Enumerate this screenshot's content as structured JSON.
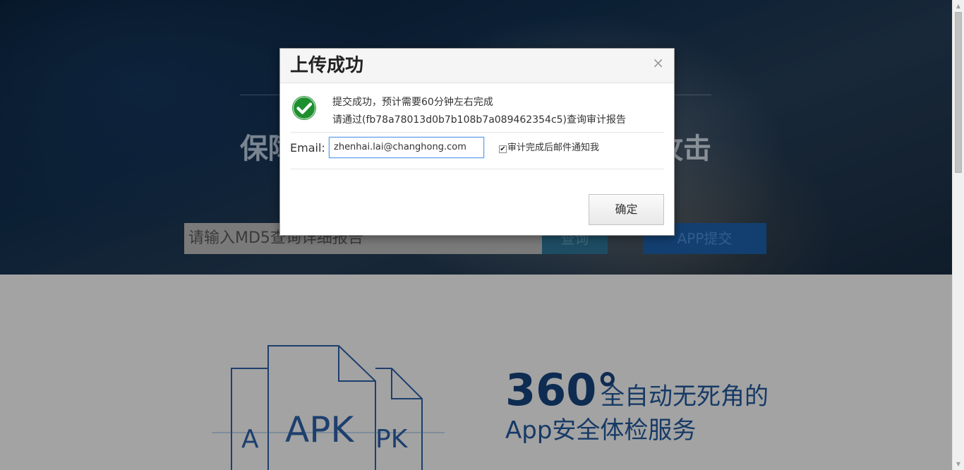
{
  "hero": {
    "title_left": "保障",
    "title_right": "攻击",
    "md5_placeholder": "请输入MD5查询详细报告",
    "query_button": "查询",
    "submit_button": "APP提交"
  },
  "feature": {
    "big": "360°",
    "line1": "全自动无死角的",
    "line2": "App安全体检服务",
    "apk_label": "APK",
    "apk_left": "A",
    "apk_right": "PK"
  },
  "dialog": {
    "title": "上传成功",
    "close": "×",
    "message_line1": "提交成功，预计需要60分钟左右完成",
    "message_line2": "请通过(fb78a78013d0b7b108b7a089462354c5)查询审计报告",
    "email_label": "Email:",
    "email_value": "zhenhai.lai@changhong.com",
    "notify_checked": true,
    "notify_label": "审计完成后邮件通知我",
    "confirm_button": "确定",
    "success_icon": "check-circle-icon",
    "success_color": "#1e8f2e"
  }
}
